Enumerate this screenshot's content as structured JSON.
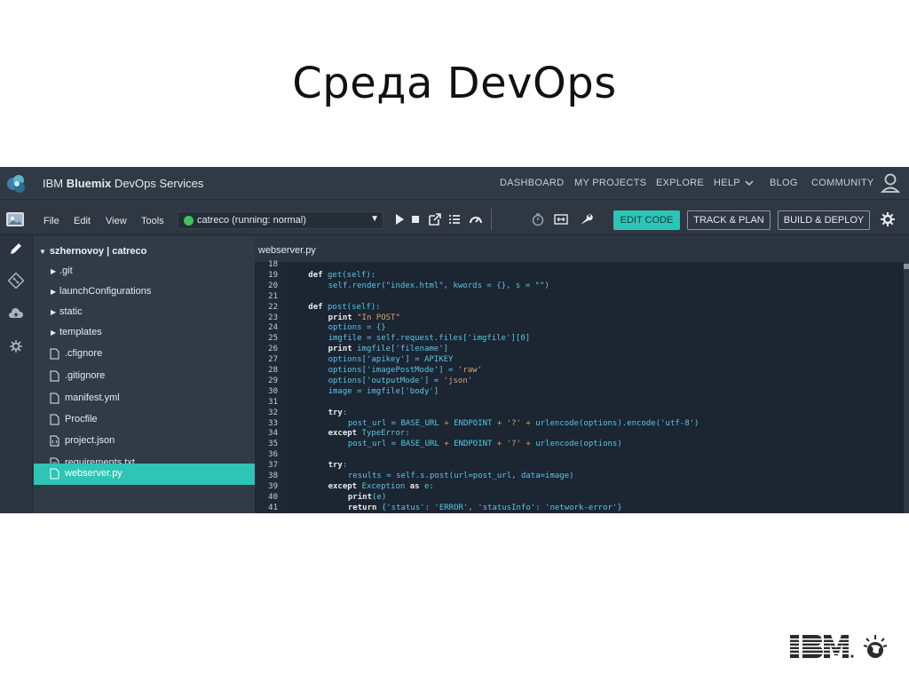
{
  "slide": {
    "title": "Среда DevOps"
  },
  "topbar": {
    "brand_bold": "IBM Bluemix",
    "brand_prefix": "IBM ",
    "brand_name": "Bluemix",
    "brand_suffix": " DevOps Services",
    "nav": [
      "DASHBOARD",
      "MY PROJECTS",
      "EXPLORE",
      "HELP",
      "BLOG",
      "COMMUNITY"
    ]
  },
  "toolbar": {
    "menus": [
      "File",
      "Edit",
      "View",
      "Tools"
    ],
    "run_status": "catreco (running: normal)",
    "run_status_color": "#3fc45f",
    "buttons": {
      "edit_code": "EDIT CODE",
      "track_plan": "TRACK & PLAN",
      "build_deploy": "BUILD & DEPLOY"
    },
    "accent": "#2ec4b6"
  },
  "tree": {
    "header": "szhernovoy | catreco",
    "folders": [
      ".git",
      "launchConfigurations",
      "static",
      "templates"
    ],
    "files": [
      {
        "name": ".cfignore",
        "icon": "file-icon"
      },
      {
        "name": ".gitignore",
        "icon": "file-icon"
      },
      {
        "name": "manifest.yml",
        "icon": "file-icon"
      },
      {
        "name": "Procfile",
        "icon": "file-icon"
      },
      {
        "name": "project.json",
        "icon": "json-file-icon"
      },
      {
        "name": "requirements.txt",
        "icon": "text-file-icon"
      },
      {
        "name": "webserver.py",
        "icon": "file-icon",
        "selected": true
      }
    ]
  },
  "editor": {
    "tab": "webserver.py",
    "lines": [
      {
        "n": "18",
        "indent": 0,
        "t": []
      },
      {
        "n": "19",
        "indent": 1,
        "t": [
          [
            "kw",
            "def "
          ],
          [
            "id",
            "get(self):"
          ]
        ]
      },
      {
        "n": "20",
        "indent": 2,
        "t": [
          [
            "id",
            "self.render(\"index.html\", kwords = {}, s = \"\")"
          ]
        ]
      },
      {
        "n": "21",
        "indent": 0,
        "t": []
      },
      {
        "n": "22",
        "indent": 1,
        "t": [
          [
            "kw",
            "def "
          ],
          [
            "id",
            "post(self):"
          ]
        ]
      },
      {
        "n": "23",
        "indent": 2,
        "t": [
          [
            "kw",
            "print "
          ],
          [
            "st",
            "\"In POST\""
          ]
        ]
      },
      {
        "n": "24",
        "indent": 2,
        "t": [
          [
            "id",
            "options = {}"
          ]
        ]
      },
      {
        "n": "25",
        "indent": 2,
        "t": [
          [
            "id",
            "imgfile = self.request.files['imgfile'][0]"
          ]
        ]
      },
      {
        "n": "26",
        "indent": 2,
        "t": [
          [
            "kw",
            "print "
          ],
          [
            "id",
            "imgfile['filename']"
          ]
        ]
      },
      {
        "n": "27",
        "indent": 2,
        "t": [
          [
            "id",
            "options['apikey'] = APIKEY"
          ]
        ]
      },
      {
        "n": "28",
        "indent": 2,
        "t": [
          [
            "id",
            "options['imagePostMode'] = "
          ],
          [
            "st",
            "'raw'"
          ]
        ]
      },
      {
        "n": "29",
        "indent": 2,
        "t": [
          [
            "id",
            "options['outputMode'] = "
          ],
          [
            "st",
            "'json'"
          ]
        ]
      },
      {
        "n": "30",
        "indent": 2,
        "t": [
          [
            "id",
            "image = imgfile['body']"
          ]
        ]
      },
      {
        "n": "31",
        "indent": 0,
        "t": []
      },
      {
        "n": "32",
        "indent": 2,
        "t": [
          [
            "kw",
            "try"
          ],
          [
            "id",
            ":"
          ]
        ]
      },
      {
        "n": "33",
        "indent": 3,
        "t": [
          [
            "id",
            "post_url = BASE_URL "
          ],
          [
            "op",
            "+"
          ],
          [
            "id",
            " ENDPOINT "
          ],
          [
            "op",
            "+"
          ],
          [
            "st",
            " '?' "
          ],
          [
            "op",
            "+"
          ],
          [
            "id",
            " urlencode(options).encode('utf-8')"
          ]
        ]
      },
      {
        "n": "34",
        "indent": 2,
        "t": [
          [
            "kw",
            "except "
          ],
          [
            "id",
            "TypeError:"
          ]
        ]
      },
      {
        "n": "35",
        "indent": 3,
        "t": [
          [
            "id",
            "post_url = BASE_URL "
          ],
          [
            "op",
            "+"
          ],
          [
            "id",
            " ENDPOINT "
          ],
          [
            "op",
            "+"
          ],
          [
            "st",
            " '?' "
          ],
          [
            "op",
            "+"
          ],
          [
            "id",
            " urlencode(options)"
          ]
        ]
      },
      {
        "n": "36",
        "indent": 0,
        "t": []
      },
      {
        "n": "37",
        "indent": 2,
        "t": [
          [
            "kw",
            "try"
          ],
          [
            "id",
            ":"
          ]
        ]
      },
      {
        "n": "38",
        "indent": 3,
        "t": [
          [
            "id",
            "results = self.s.post(url=post_url, data=image)"
          ]
        ]
      },
      {
        "n": "39",
        "indent": 2,
        "t": [
          [
            "kw",
            "except "
          ],
          [
            "id",
            "Exception "
          ],
          [
            "kw",
            "as "
          ],
          [
            "id",
            "e:"
          ]
        ]
      },
      {
        "n": "40",
        "indent": 3,
        "t": [
          [
            "kw",
            "print"
          ],
          [
            "id",
            "(e)"
          ]
        ]
      },
      {
        "n": "41",
        "indent": 3,
        "t": [
          [
            "kw",
            "return "
          ],
          [
            "id",
            "{'status': 'ERROR', 'statusInfo': 'network-error'}"
          ]
        ]
      }
    ]
  },
  "footer": {
    "logo_text": "IBM"
  }
}
